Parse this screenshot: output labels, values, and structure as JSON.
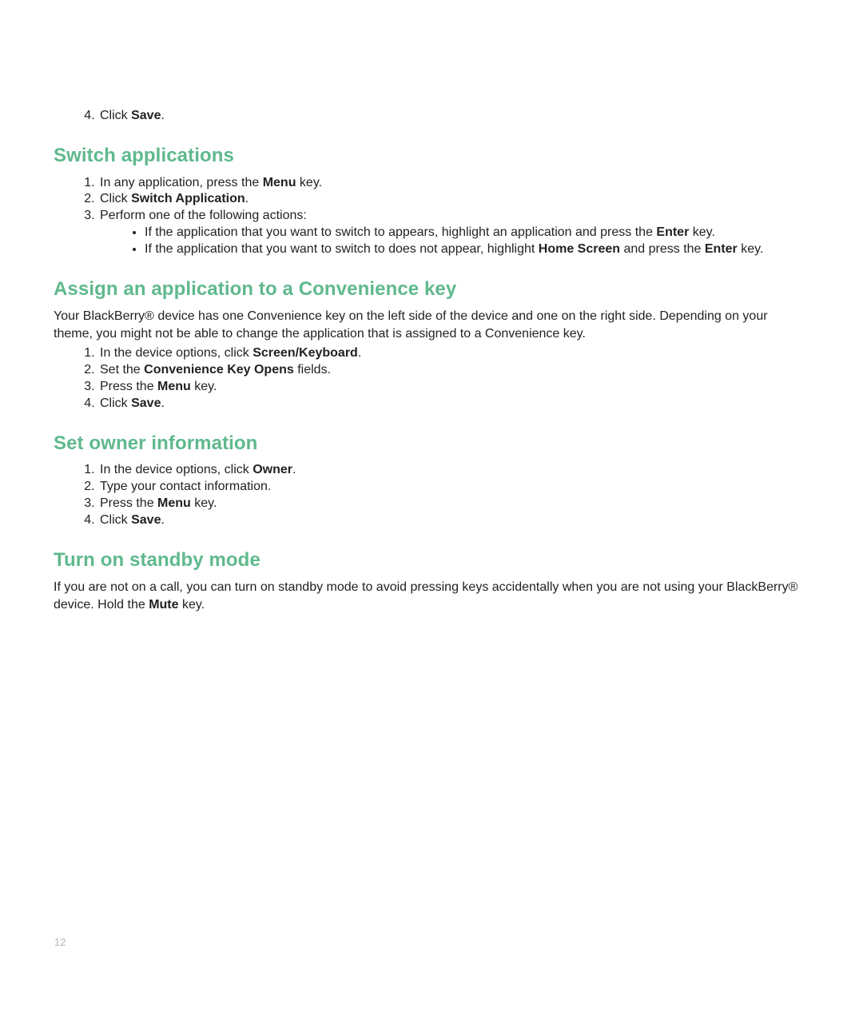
{
  "colors": {
    "heading": "#5fb98d"
  },
  "step4": {
    "marker": "4.",
    "pre": "Click ",
    "bold": "Save",
    "post": "."
  },
  "sections": [
    {
      "heading": "Switch applications",
      "items": [
        {
          "type": "li",
          "pre": "In any application, press the ",
          "bold": "Menu",
          "post": " key."
        },
        {
          "type": "li",
          "pre": "Click ",
          "bold": "Switch Application",
          "post": "."
        },
        {
          "type": "li",
          "pre": "Perform one of the following actions:",
          "bold": "",
          "post": ""
        }
      ],
      "sub": [
        {
          "pre": "If the application that you want to switch to appears, highlight an application and press the ",
          "bold": "Enter",
          "post": " key."
        },
        {
          "pre": "If the application that you want to switch to does not appear, highlight ",
          "bold": "Home Screen",
          "mid": " and press the ",
          "bold2": "Enter",
          "post": " key."
        }
      ]
    },
    {
      "heading": "Assign an application to a Convenience key",
      "intro": "Your BlackBerry® device has one Convenience key on the left side of the device and one on the right side. Depending on your theme, you might not be able to change the application that is assigned to a Convenience key.",
      "items": [
        {
          "type": "li",
          "pre": "In the device options, click ",
          "bold": "Screen/Keyboard",
          "post": "."
        },
        {
          "type": "li",
          "pre": "Set the ",
          "bold": "Convenience Key Opens",
          "post": " fields."
        },
        {
          "type": "li",
          "pre": "Press the ",
          "bold": "Menu",
          "post": " key."
        },
        {
          "type": "li",
          "pre": "Click ",
          "bold": "Save",
          "post": "."
        }
      ]
    },
    {
      "heading": "Set owner information",
      "items": [
        {
          "type": "li",
          "pre": "In the device options, click ",
          "bold": "Owner",
          "post": "."
        },
        {
          "type": "li",
          "pre": "Type your contact information.",
          "bold": "",
          "post": ""
        },
        {
          "type": "li",
          "pre": "Press the ",
          "bold": "Menu",
          "post": " key."
        },
        {
          "type": "li",
          "pre": "Click ",
          "bold": "Save",
          "post": "."
        }
      ]
    },
    {
      "heading": "Turn on standby mode",
      "body_parts": {
        "pre": "If you are not on a call, you can turn on standby mode to avoid pressing keys accidentally when you are not using your BlackBerry® device. Hold the ",
        "bold": "Mute",
        "post": " key."
      }
    }
  ],
  "page_number": "12"
}
